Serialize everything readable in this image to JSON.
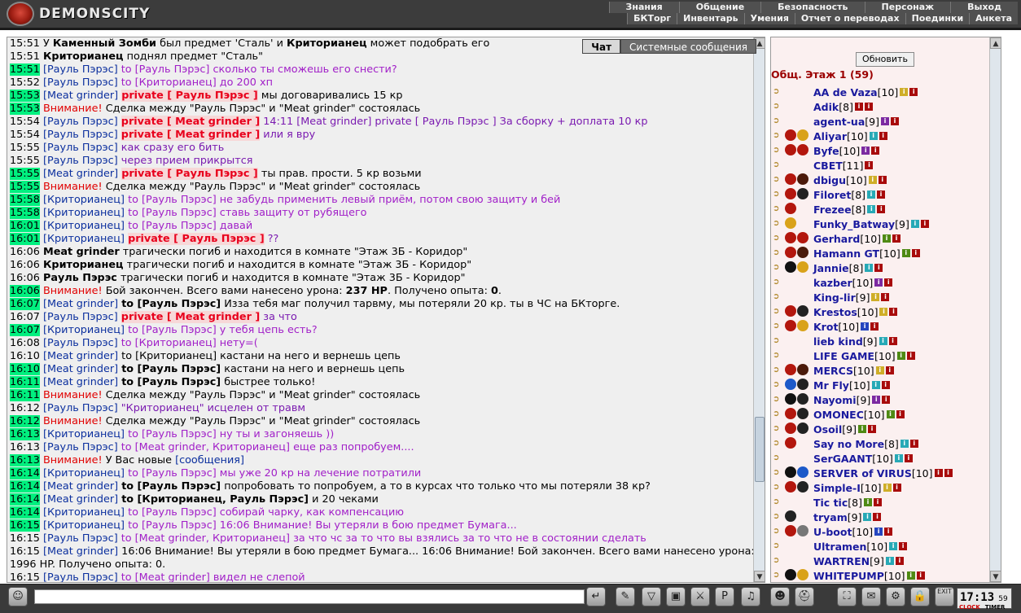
{
  "app": {
    "title": "DEMONSCITY"
  },
  "menu": {
    "top": [
      "Знания",
      "Общение",
      "Безопасность",
      "Персонаж",
      "Выход"
    ],
    "bottom": [
      "БКТорг",
      "Инвентарь",
      "Умения",
      "Отчет о переводах",
      "Поединки",
      "Анкета"
    ]
  },
  "chat": {
    "tabs": [
      "Чат",
      "Системные сообщения"
    ],
    "lines": [
      [
        [
          "t",
          "15:51"
        ],
        [
          "x",
          " У "
        ],
        [
          "b",
          "Каменный Зомби"
        ],
        [
          "x",
          " был предмет 'Сталь' и "
        ],
        [
          "b",
          "Криторианец"
        ],
        [
          "x",
          " может подобрать его"
        ]
      ],
      [
        [
          "t",
          "15:51"
        ],
        [
          "x",
          " "
        ],
        [
          "b",
          "Криторианец"
        ],
        [
          "x",
          " поднял предмет \"Сталь\""
        ]
      ],
      [
        [
          "th",
          "15:51"
        ],
        [
          "x",
          " "
        ],
        [
          "u",
          "[Рауль Пэрэс]"
        ],
        [
          "p",
          " to [Рауль Пэрэс] сколько ты сможешь его снести?"
        ]
      ],
      [
        [
          "t",
          "15:52"
        ],
        [
          "x",
          " "
        ],
        [
          "u",
          "[Рауль Пэрэс]"
        ],
        [
          "p",
          " to [Криторианец] до 200 хп"
        ]
      ],
      [
        [
          "th",
          "15:53"
        ],
        [
          "x",
          " "
        ],
        [
          "u",
          "[Meat grinder]"
        ],
        [
          "x",
          " "
        ],
        [
          "pv",
          "private [ Рауль Пэрэс ]"
        ],
        [
          "x",
          " мы договаривались 15 кр"
        ]
      ],
      [
        [
          "th",
          "15:53"
        ],
        [
          "x",
          " "
        ],
        [
          "w",
          "Внимание!"
        ],
        [
          "x",
          " Сделка между \"Рауль Пэрэс\" и \"Meat grinder\" состоялась"
        ]
      ],
      [
        [
          "t",
          "15:54"
        ],
        [
          "x",
          " "
        ],
        [
          "u",
          "[Рауль Пэрэс]"
        ],
        [
          "x",
          " "
        ],
        [
          "pv",
          "private [ Meat grinder ]"
        ],
        [
          "ts",
          " 14:11 [Meat grinder] private [ Рауль Пэрэс ] За сборку + доплата 10 кр"
        ]
      ],
      [
        [
          "t",
          "15:54"
        ],
        [
          "x",
          " "
        ],
        [
          "u",
          "[Рауль Пэрэс]"
        ],
        [
          "x",
          " "
        ],
        [
          "pv",
          "private [ Meat grinder ]"
        ],
        [
          "ts",
          " или я вру"
        ]
      ],
      [
        [
          "t",
          "15:55"
        ],
        [
          "x",
          " "
        ],
        [
          "u",
          "[Рауль Пэрэс]"
        ],
        [
          "ts",
          " как сразу его бить"
        ]
      ],
      [
        [
          "t",
          "15:55"
        ],
        [
          "x",
          " "
        ],
        [
          "u",
          "[Рауль Пэрэс]"
        ],
        [
          "ts",
          " через прием прикрытся"
        ]
      ],
      [
        [
          "th",
          "15:55"
        ],
        [
          "x",
          " "
        ],
        [
          "u",
          "[Meat grinder]"
        ],
        [
          "x",
          " "
        ],
        [
          "pv",
          "private [ Рауль Пэрэс ]"
        ],
        [
          "x",
          " ты прав. прости. 5 кр возьми"
        ]
      ],
      [
        [
          "th",
          "15:55"
        ],
        [
          "x",
          " "
        ],
        [
          "w",
          "Внимание!"
        ],
        [
          "x",
          " Сделка между \"Рауль Пэрэс\" и \"Meat grinder\" состоялась"
        ]
      ],
      [
        [
          "th",
          "15:58"
        ],
        [
          "x",
          " "
        ],
        [
          "u",
          "[Криторианец]"
        ],
        [
          "p",
          " to [Рауль Пэрэс] не забудь применить левый приём, потом свою защиту и бей"
        ]
      ],
      [
        [
          "th",
          "15:58"
        ],
        [
          "x",
          " "
        ],
        [
          "u",
          "[Криторианец]"
        ],
        [
          "p",
          " to [Рауль Пэрэс] ставь защиту от рубящего"
        ]
      ],
      [
        [
          "th",
          "16:01"
        ],
        [
          "x",
          " "
        ],
        [
          "u",
          "[Криторианец]"
        ],
        [
          "p",
          " to [Рауль Пэрэс] давай"
        ]
      ],
      [
        [
          "th",
          "16:01"
        ],
        [
          "x",
          " "
        ],
        [
          "u",
          "[Криторианец]"
        ],
        [
          "x",
          " "
        ],
        [
          "pv",
          "private [ Рауль Пэрэс ]"
        ],
        [
          "ts",
          " ??"
        ]
      ],
      [
        [
          "t",
          "16:06"
        ],
        [
          "x",
          " "
        ],
        [
          "b",
          "Meat grinder"
        ],
        [
          "x",
          " трагически погиб и находится в комнате \"Этаж 3Б - Коридор\""
        ]
      ],
      [
        [
          "t",
          "16:06"
        ],
        [
          "x",
          " "
        ],
        [
          "b",
          "Криторианец"
        ],
        [
          "x",
          " трагически погиб и находится в комнате \"Этаж 3Б - Коридор\""
        ]
      ],
      [
        [
          "t",
          "16:06"
        ],
        [
          "x",
          " "
        ],
        [
          "b",
          "Рауль Пэрэс"
        ],
        [
          "x",
          " трагически погиб и находится в комнате \"Этаж 3Б - Коридор\""
        ]
      ],
      [
        [
          "th",
          "16:06"
        ],
        [
          "x",
          " "
        ],
        [
          "w",
          "Внимание!"
        ],
        [
          "x",
          " Бой закончен. Всего вами нанесено урона: "
        ],
        [
          "b",
          "237 HP"
        ],
        [
          "x",
          ". Получено опыта: "
        ],
        [
          "b",
          "0"
        ],
        [
          "x",
          "."
        ]
      ],
      [
        [
          "th",
          "16:07"
        ],
        [
          "x",
          " "
        ],
        [
          "u",
          "[Meat grinder]"
        ],
        [
          "x",
          " "
        ],
        [
          "b",
          "to [Рауль Пэрэс]"
        ],
        [
          "x",
          " Изза тебя маг получил тарвму, мы потеряли 20 кр. ты в ЧС на БКторге."
        ]
      ],
      [
        [
          "t",
          "16:07"
        ],
        [
          "x",
          " "
        ],
        [
          "u",
          "[Рауль Пэрэс]"
        ],
        [
          "x",
          " "
        ],
        [
          "pv",
          "private [ Meat grinder ]"
        ],
        [
          "ts",
          " за что"
        ]
      ],
      [
        [
          "th",
          "16:07"
        ],
        [
          "x",
          " "
        ],
        [
          "u",
          "[Криторианец]"
        ],
        [
          "p",
          " to [Рауль Пэрэс] у тебя цепь есть?"
        ]
      ],
      [
        [
          "t",
          "16:08"
        ],
        [
          "x",
          " "
        ],
        [
          "u",
          "[Рауль Пэрэс]"
        ],
        [
          "p",
          " to [Криторианец] нету=("
        ]
      ],
      [
        [
          "t",
          "16:10"
        ],
        [
          "x",
          " "
        ],
        [
          "u",
          "[Meat grinder]"
        ],
        [
          "x",
          " to [Криторианец] кастани на него и вернешь цепь"
        ]
      ],
      [
        [
          "th",
          "16:10"
        ],
        [
          "x",
          " "
        ],
        [
          "u",
          "[Meat grinder]"
        ],
        [
          "x",
          " "
        ],
        [
          "b",
          "to [Рауль Пэрэс]"
        ],
        [
          "x",
          " кастани на него и вернешь цепь"
        ]
      ],
      [
        [
          "th",
          "16:11"
        ],
        [
          "x",
          " "
        ],
        [
          "u",
          "[Meat grinder]"
        ],
        [
          "x",
          " "
        ],
        [
          "b",
          "to [Рауль Пэрэс]"
        ],
        [
          "x",
          " быстрее только!"
        ]
      ],
      [
        [
          "th",
          "16:11"
        ],
        [
          "x",
          " "
        ],
        [
          "w",
          "Внимание!"
        ],
        [
          "x",
          " Сделка между \"Рауль Пэрэс\" и \"Meat grinder\" состоялась"
        ]
      ],
      [
        [
          "t",
          "16:12"
        ],
        [
          "x",
          " "
        ],
        [
          "u",
          "[Рауль Пэрэс]"
        ],
        [
          "ts",
          " \"Криторианец\" исцелен от травм"
        ]
      ],
      [
        [
          "th",
          "16:12"
        ],
        [
          "x",
          " "
        ],
        [
          "w",
          "Внимание!"
        ],
        [
          "x",
          " Сделка между \"Рауль Пэрэс\" и \"Meat grinder\" состоялась"
        ]
      ],
      [
        [
          "th",
          "16:13"
        ],
        [
          "x",
          " "
        ],
        [
          "u",
          "[Криторианец]"
        ],
        [
          "p",
          " to [Рауль Пэрэс] ну ты и загоняешь ))"
        ]
      ],
      [
        [
          "t",
          "16:13"
        ],
        [
          "x",
          " "
        ],
        [
          "u",
          "[Рауль Пэрэс]"
        ],
        [
          "p",
          " to [Meat grinder, Криторианец] еще раз попробуем...."
        ]
      ],
      [
        [
          "th",
          "16:13"
        ],
        [
          "x",
          " "
        ],
        [
          "w",
          "Внимание!"
        ],
        [
          "x",
          " У Вас новые "
        ],
        [
          "u",
          "[сообщения]"
        ]
      ],
      [
        [
          "th",
          "16:14"
        ],
        [
          "x",
          " "
        ],
        [
          "u",
          "[Криторианец]"
        ],
        [
          "p",
          " to [Рауль Пэрэс] мы уже 20 кр на лечение потратили"
        ]
      ],
      [
        [
          "th",
          "16:14"
        ],
        [
          "x",
          " "
        ],
        [
          "u",
          "[Meat grinder]"
        ],
        [
          "x",
          " "
        ],
        [
          "b",
          "to [Рауль Пэрэс]"
        ],
        [
          "x",
          " попробовать то попробуем, а то в курсах что только что мы потеряли 38 кр?"
        ]
      ],
      [
        [
          "th",
          "16:14"
        ],
        [
          "x",
          " "
        ],
        [
          "u",
          "[Meat grinder]"
        ],
        [
          "x",
          " "
        ],
        [
          "b",
          "to [Криторианец, Рауль Пэрэс]"
        ],
        [
          "x",
          " и 20 чеками"
        ]
      ],
      [
        [
          "th",
          "16:14"
        ],
        [
          "x",
          " "
        ],
        [
          "u",
          "[Криторианец]"
        ],
        [
          "p",
          " to [Рауль Пэрэс] собирай чарку, как компенсацию"
        ]
      ],
      [
        [
          "th",
          "16:15"
        ],
        [
          "x",
          " "
        ],
        [
          "u",
          "[Криторианец]"
        ],
        [
          "p",
          " to [Рауль Пэрэс] 16:06 Внимание! Вы утеряли в бою предмет Бумага..."
        ]
      ],
      [
        [
          "t",
          "16:15"
        ],
        [
          "x",
          " "
        ],
        [
          "u",
          "[Рауль Пэрэс]"
        ],
        [
          "p",
          " to [Meat grinder, Криторианец] за что чс за то что вы взялись за то что не в состоянии сделать"
        ]
      ],
      [
        [
          "t",
          "16:15"
        ],
        [
          "x",
          " "
        ],
        [
          "u",
          "[Meat grinder]"
        ],
        [
          "x",
          " 16:06 Внимание! Вы утеряли в бою предмет Бумага... 16:06 Внимание! Бой закончен. Всего вами нанесено урона: 1996 HP. Получено опыта: 0."
        ]
      ],
      [
        [
          "t",
          "16:15"
        ],
        [
          "x",
          " "
        ],
        [
          "u",
          "[Рауль Пэрэс]"
        ],
        [
          "p",
          " to [Meat grinder]  видел не слепой"
        ]
      ]
    ]
  },
  "users": {
    "refresh_label": "Обновить",
    "room": "Общ. Этаж 1 (59)",
    "list": [
      {
        "nick": "AA de Vaza",
        "lvl": "[10]",
        "icons": [],
        "tags": [
          "y",
          "r"
        ]
      },
      {
        "nick": "Adik",
        "lvl": "[8]",
        "icons": [],
        "tags": [
          "r",
          "r"
        ]
      },
      {
        "nick": "agent-ua",
        "lvl": "[9]",
        "icons": [],
        "tags": [
          "v",
          "r"
        ]
      },
      {
        "nick": "Aliyar",
        "lvl": "[10]",
        "icons": [
          "red",
          "gold"
        ],
        "tags": [
          "c",
          "r"
        ]
      },
      {
        "nick": "Byfe",
        "lvl": "[10]",
        "icons": [
          "red",
          "red"
        ],
        "tags": [
          "v",
          "r"
        ]
      },
      {
        "nick": "CBET",
        "lvl": "[11]",
        "icons": [],
        "tags": [
          "r"
        ]
      },
      {
        "nick": "dbigu",
        "lvl": "[10]",
        "icons": [
          "red",
          "dark"
        ],
        "tags": [
          "y",
          "r"
        ]
      },
      {
        "nick": "Filoret",
        "lvl": "[8]",
        "icons": [
          "red",
          "black"
        ],
        "tags": [
          "c",
          "r"
        ]
      },
      {
        "nick": "Frezee",
        "lvl": "[8]",
        "icons": [
          "red"
        ],
        "tags": [
          "c",
          "r"
        ]
      },
      {
        "nick": "Funky_Batway",
        "lvl": "[9]",
        "icons": [
          "gold"
        ],
        "tags": [
          "c",
          "r"
        ]
      },
      {
        "nick": "Gerhard",
        "lvl": "[10]",
        "icons": [
          "red",
          "red"
        ],
        "tags": [
          "g",
          "r"
        ]
      },
      {
        "nick": "Hamann GT",
        "lvl": "[10]",
        "icons": [
          "red",
          "dark"
        ],
        "tags": [
          "g",
          "r"
        ]
      },
      {
        "nick": "Jannie",
        "lvl": "[8]",
        "icons": [
          "yin",
          "gold"
        ],
        "tags": [
          "c",
          "r"
        ]
      },
      {
        "nick": "kazber",
        "lvl": "[10]",
        "icons": [],
        "tags": [
          "v",
          "r"
        ]
      },
      {
        "nick": "King-lir",
        "lvl": "[9]",
        "icons": [],
        "tags": [
          "y",
          "r"
        ]
      },
      {
        "nick": "Krestos",
        "lvl": "[10]",
        "icons": [
          "red",
          "black"
        ],
        "tags": [
          "y",
          "r"
        ]
      },
      {
        "nick": "Krot",
        "lvl": "[10]",
        "icons": [
          "red",
          "gold"
        ],
        "tags": [
          "b",
          "r"
        ]
      },
      {
        "nick": "lieb kind",
        "lvl": "[9]",
        "icons": [],
        "tags": [
          "c",
          "r"
        ]
      },
      {
        "nick": "LIFE GAME",
        "lvl": "[10]",
        "icons": [],
        "tags": [
          "g",
          "r"
        ]
      },
      {
        "nick": "MERCS",
        "lvl": "[10]",
        "icons": [
          "red",
          "dark"
        ],
        "tags": [
          "y",
          "r"
        ]
      },
      {
        "nick": "Mr Fly",
        "lvl": "[10]",
        "icons": [
          "blue",
          "black"
        ],
        "tags": [
          "c",
          "r"
        ]
      },
      {
        "nick": "Nayomi",
        "lvl": "[9]",
        "icons": [
          "yin",
          "black"
        ],
        "tags": [
          "v",
          "r"
        ]
      },
      {
        "nick": "OMONEC",
        "lvl": "[10]",
        "icons": [
          "red",
          "black"
        ],
        "tags": [
          "g",
          "r"
        ]
      },
      {
        "nick": "Osoil",
        "lvl": "[9]",
        "icons": [
          "red",
          "black"
        ],
        "tags": [
          "g",
          "r"
        ]
      },
      {
        "nick": "Say no More",
        "lvl": "[8]",
        "icons": [
          "red"
        ],
        "tags": [
          "c",
          "r"
        ]
      },
      {
        "nick": "SerGAANT",
        "lvl": "[10]",
        "icons": [],
        "tags": [
          "c",
          "r"
        ]
      },
      {
        "nick": "SERVER of VIRUS",
        "lvl": "[10]",
        "icons": [
          "yin",
          "blue"
        ],
        "tags": [
          "r",
          "r"
        ]
      },
      {
        "nick": "Simple-I",
        "lvl": "[10]",
        "icons": [
          "red",
          "black"
        ],
        "tags": [
          "y",
          "r"
        ]
      },
      {
        "nick": "Tic tic",
        "lvl": "[8]",
        "icons": [],
        "tags": [
          "g",
          "r"
        ]
      },
      {
        "nick": "tryam",
        "lvl": "[9]",
        "icons": [
          "black"
        ],
        "tags": [
          "c",
          "r"
        ]
      },
      {
        "nick": "U-boot",
        "lvl": "[10]",
        "icons": [
          "red",
          "grey"
        ],
        "tags": [
          "b",
          "r"
        ]
      },
      {
        "nick": "Ultramen",
        "lvl": "[10]",
        "icons": [],
        "tags": [
          "c",
          "r"
        ]
      },
      {
        "nick": "WARTREN",
        "lvl": "[9]",
        "icons": [],
        "tags": [
          "c",
          "r"
        ]
      },
      {
        "nick": "WHITEPUMP",
        "lvl": "[10]",
        "icons": [
          "yin",
          "gold"
        ],
        "tags": [
          "g",
          "r"
        ]
      }
    ]
  },
  "bottom": {
    "clock": "17:13",
    "seconds": "59",
    "clock_label": "CLOCK",
    "timer_label": "TIMER",
    "exit_label": "EXIT"
  },
  "colors": {
    "timestamp_highlight": "#00f07f",
    "nick": "#0b2f9e",
    "private": "#e8001c",
    "attention": "#e10000",
    "to_text": "#a11fc8",
    "panel_bg": "#fbf0f0"
  }
}
